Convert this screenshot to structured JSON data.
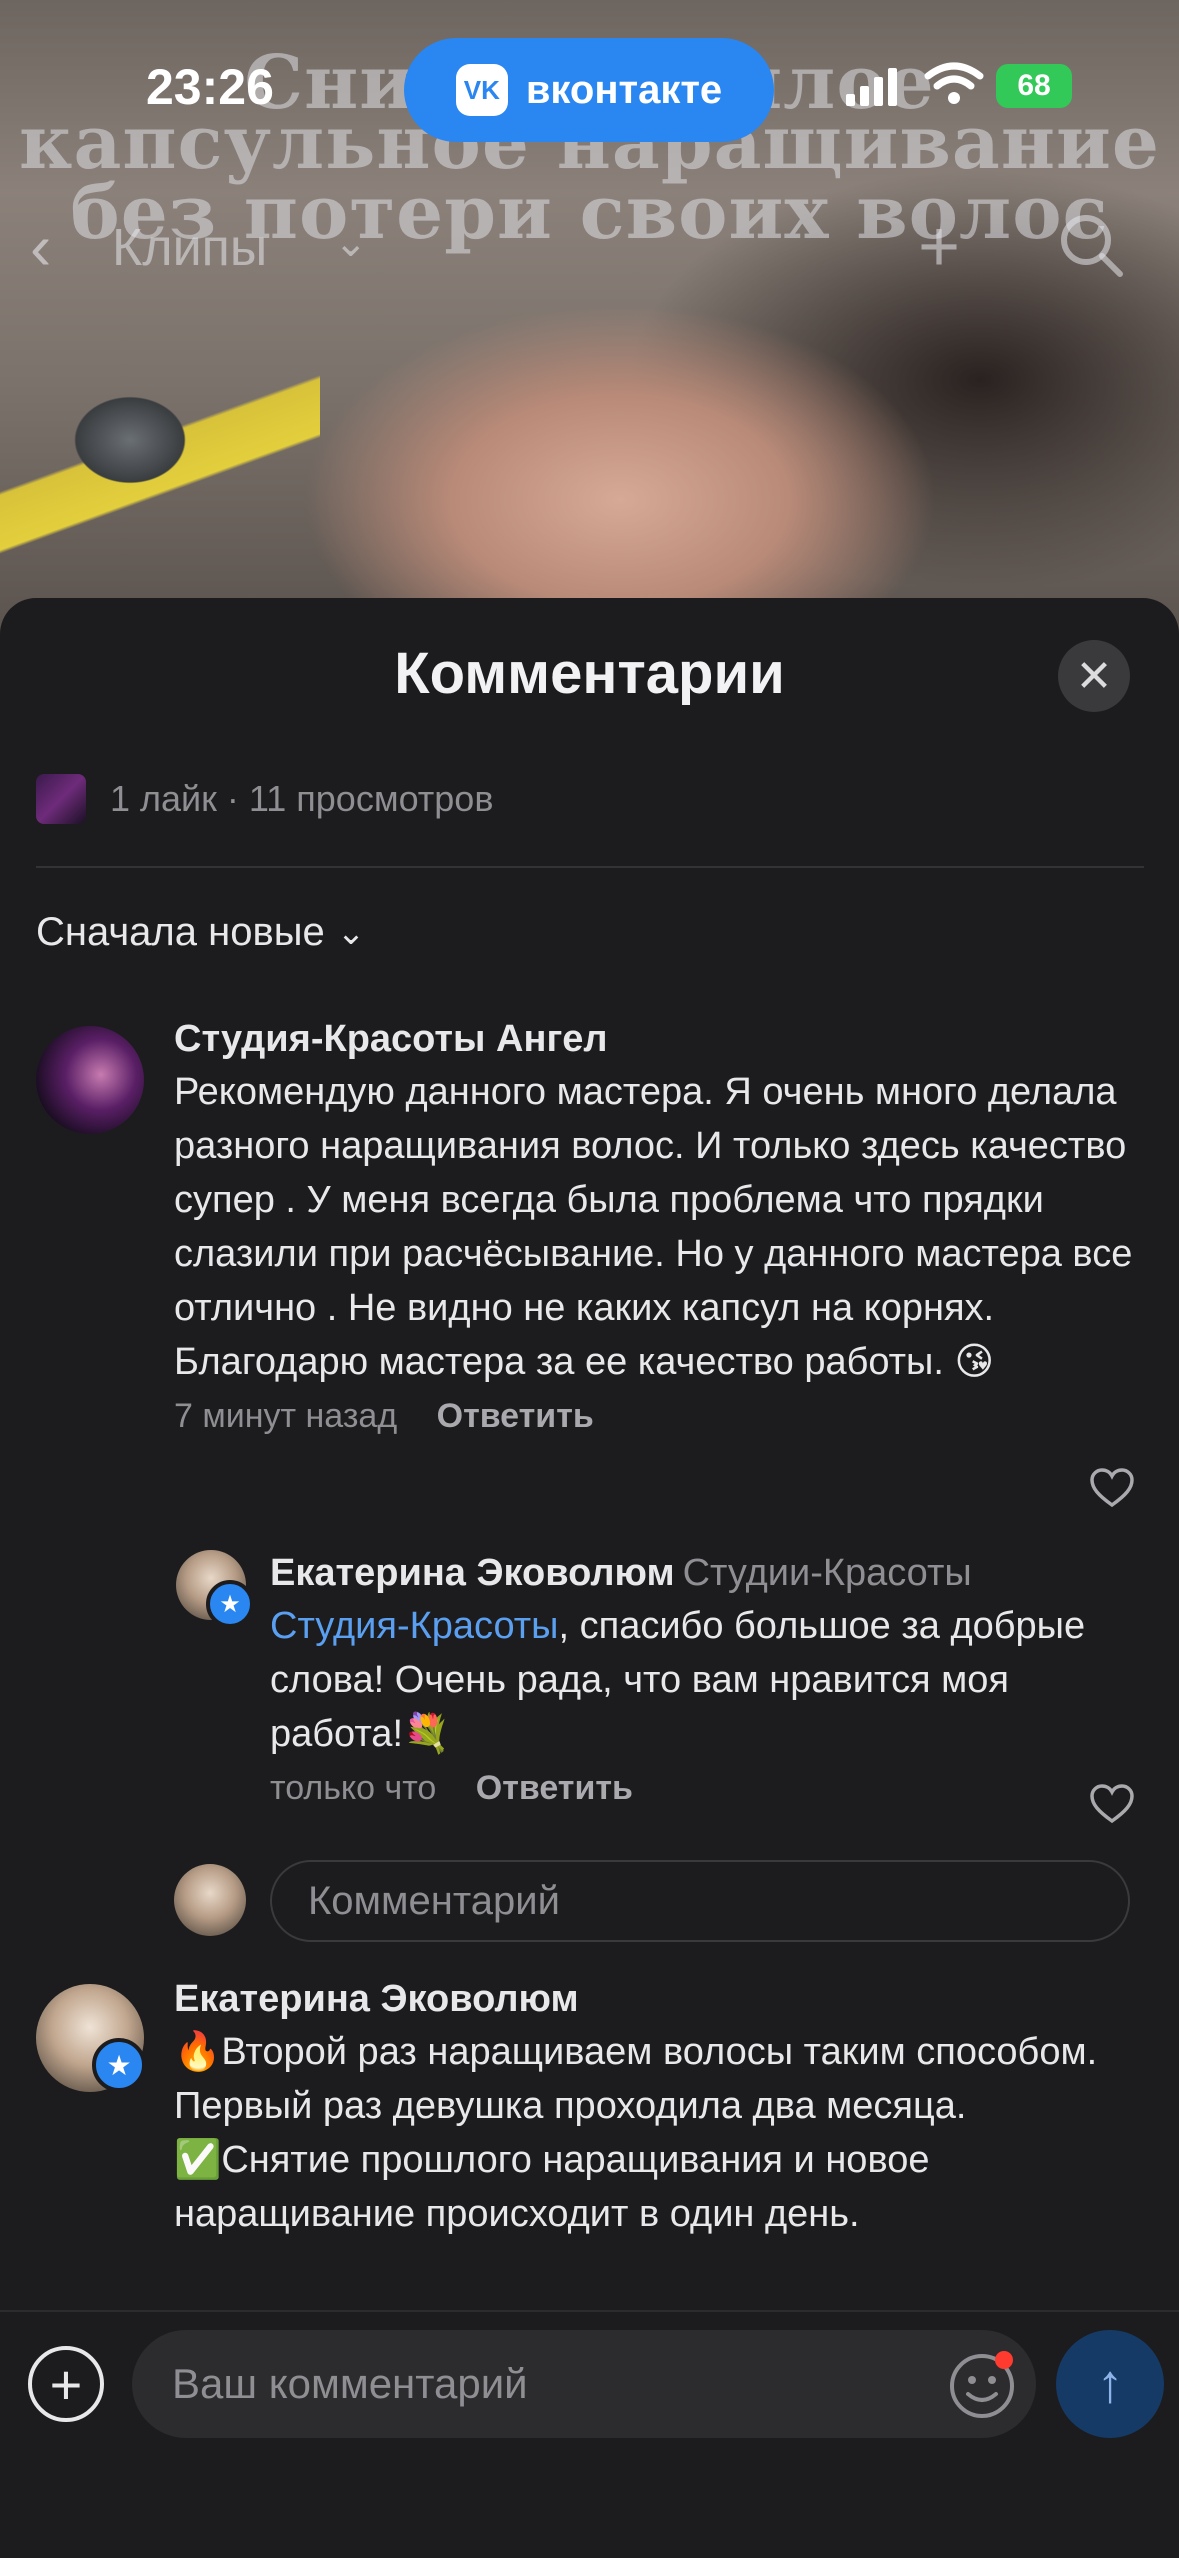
{
  "status": {
    "time": "23:26",
    "app_pill": "вконтакте",
    "vk_logo": "VK",
    "battery": "68"
  },
  "nav": {
    "title": "Клипы"
  },
  "video": {
    "line1": "Снимаю теплое",
    "line2": "капсульное наращивание",
    "line3": "без потери своих волос"
  },
  "sheet": {
    "title": "Комментарии",
    "stats": "1 лайк · 11 просмотров",
    "sort_label": "Сначала новые"
  },
  "comments": [
    {
      "author": "Студия-Красоты Ангел",
      "text": "Рекомендую данного мастера. Я очень много делала разного наращивания волос. И только здесь качество супер . У меня всегда была проблема что прядки слазили при расчёсывание. Но у данного мастера все отлично . Не видно не каких капсул на корнях. Благодарю мастера за ее качество работы. 😘",
      "time": "7 минут назад",
      "reply": "Ответить"
    },
    {
      "author": "Екатерина Эковолюм",
      "author_sub": "Студии-Красоты",
      "mention": "Студия-Красоты",
      "text": ", спасибо большое за добрые слова! Очень рада, что вам нравится моя работа!💐",
      "time": "только что",
      "reply": "Ответить"
    },
    {
      "author": "Екатерина Эковолюм",
      "text1": "🔥Второй раз наращиваем волосы таким способом.  Первый раз девушка проходила два месяца.",
      "text2": "✅Снятие прошлого наращивания и новое наращивание происходит в один день."
    }
  ],
  "inline_reply_placeholder": "Комментарий",
  "composer": {
    "placeholder": "Ваш комментарий"
  },
  "colors": {
    "accent": "#2a86f0",
    "sheet_bg": "#1c1c1e",
    "link": "#5a9ff0"
  }
}
